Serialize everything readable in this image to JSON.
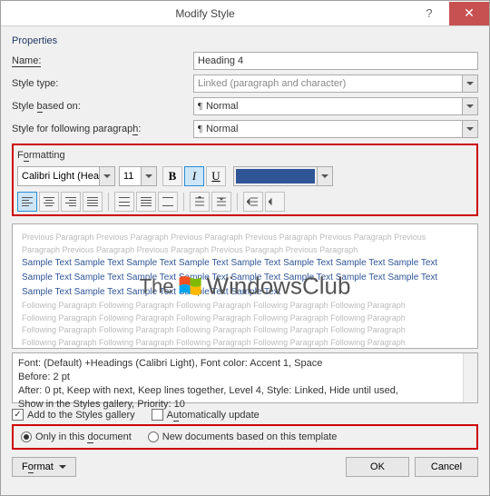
{
  "dialog": {
    "title": "Modify Style"
  },
  "properties": {
    "section": "Properties",
    "name_label": "Name:",
    "name_value": "Heading 4",
    "type_label": "Style type:",
    "type_value": "Linked (paragraph and character)",
    "based_label": "Style based on:",
    "based_value": "Normal",
    "follow_label": "Style for following paragraph:",
    "follow_value": "Normal"
  },
  "formatting": {
    "section": "Formatting",
    "font": "Calibri Light (Headings)",
    "size": "11",
    "bold": "B",
    "italic": "I",
    "underline": "U",
    "color": "#2f5597"
  },
  "preview": {
    "prev_para": "Previous Paragraph Previous Paragraph Previous Paragraph Previous Paragraph Previous Paragraph Previous",
    "prev_para2": "Paragraph Previous Paragraph Previous Paragraph Previous Paragraph Previous Paragraph",
    "sample1": "Sample Text Sample Text Sample Text Sample Text Sample Text Sample Text Sample Text Sample Text",
    "sample2": "Sample Text Sample Text Sample Text Sample Text Sample Text Sample Text Sample Text Sample Text",
    "sample3": "Sample Text Sample Text Sample Text Sample Text Sample Text",
    "follow_para": "Following Paragraph Following Paragraph Following Paragraph Following Paragraph Following Paragraph"
  },
  "watermark": {
    "the": "The",
    "brand": "WindowsClub"
  },
  "description": {
    "line1": "Font: (Default) +Headings (Calibri Light), Font color: Accent 1, Space",
    "line2": "   Before:  2 pt",
    "line3": "   After:  0 pt, Keep with next, Keep lines together, Level 4, Style: Linked, Hide until used,",
    "line4": "Show in the Styles gallery, Priority: 10"
  },
  "checks": {
    "add_gallery": "Add to the Styles gallery",
    "auto_update": "Automatically update"
  },
  "radios": {
    "only_doc": "Only in this document",
    "new_docs": "New documents based on this template"
  },
  "buttons": {
    "format": "Format",
    "ok": "OK",
    "cancel": "Cancel"
  }
}
